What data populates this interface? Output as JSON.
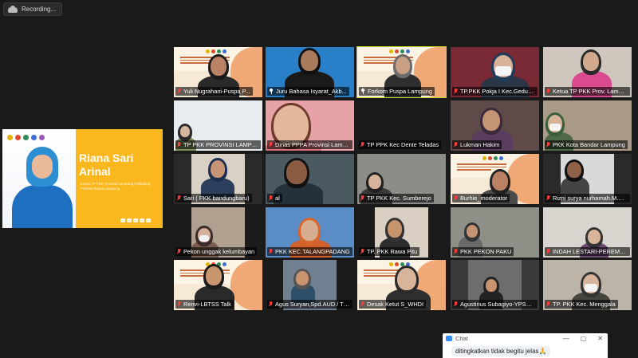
{
  "recording": {
    "label": "Recording..."
  },
  "spotlight": {
    "title": "Riana Sari Arinal",
    "subtitle": "Ketua TP PKK Provinsi Lampung Pelindung Forkom Puspa Lampung"
  },
  "participants": [
    {
      "name": "Yuli Nugrahani-Puspa P...",
      "muted": true,
      "pinned": false
    },
    {
      "name": "Juru Bahasa Isyarat_Akb...",
      "muted": false,
      "pinned": true
    },
    {
      "name": "Forkom Puspa Lampung",
      "muted": false,
      "pinned": true,
      "active": true
    },
    {
      "name": "TP.PKK Pokja I Kec.Gedung...",
      "muted": true,
      "pinned": false
    },
    {
      "name": "Ketua TP PKK Prov. Lampung -...",
      "muted": true,
      "pinned": false
    },
    {
      "name": "TP PKK PROVINSI LAMPUN...",
      "muted": true,
      "pinned": false
    },
    {
      "name": "Dinas PPPA Provinsi Lampu...",
      "muted": true,
      "pinned": false
    },
    {
      "name": "TP PPK Kec Dente Teladas",
      "muted": true,
      "pinned": false
    },
    {
      "name": "Lukman Hakim",
      "muted": true,
      "pinned": false
    },
    {
      "name": "PKK Kota Bandar Lampung",
      "muted": true,
      "pinned": false
    },
    {
      "name": "Sari ( PKK bandungbaru)",
      "muted": true,
      "pinned": false
    },
    {
      "name": "al",
      "muted": true,
      "pinned": false
    },
    {
      "name": "TP PKK Kec. Sumberejo",
      "muted": true,
      "pinned": false
    },
    {
      "name": "Burhie_moderator",
      "muted": true,
      "pinned": false
    },
    {
      "name": "Rizni surya nurhamah.M.Ke...",
      "muted": true,
      "pinned": false
    },
    {
      "name": "Pekon unggak kelumbayan",
      "muted": true,
      "pinned": false
    },
    {
      "name": "PKK KEC.TALANGPADANG",
      "muted": true,
      "pinned": false
    },
    {
      "name": "TP. PKK Rawa Pitu",
      "muted": true,
      "pinned": false
    },
    {
      "name": "PKK PEKON PAKU",
      "muted": true,
      "pinned": false
    },
    {
      "name": "INDAH LESTARI-PEREMPUA...",
      "muted": true,
      "pinned": false
    },
    {
      "name": "Renvi-LBTSS Talk",
      "muted": true,
      "pinned": false
    },
    {
      "name": "Agus Suryan,Spd.AUD / TK...",
      "muted": true,
      "pinned": false
    },
    {
      "name": "Desak Ketut S_WHDI",
      "muted": true,
      "pinned": false
    },
    {
      "name": "Agustinus Subagiyo-YPSK-...",
      "muted": true,
      "pinned": false
    },
    {
      "name": "TP. PKK Kec. Menggala",
      "muted": true,
      "pinned": false
    }
  ],
  "chat": {
    "title": "Chat",
    "message": "ditingkatkan tidak begitu jelas🙏"
  },
  "colors": {
    "active_border": "#c5d92a",
    "muted_mic": "#ff3b3b",
    "spotlight_bg": "#fbb81e"
  }
}
